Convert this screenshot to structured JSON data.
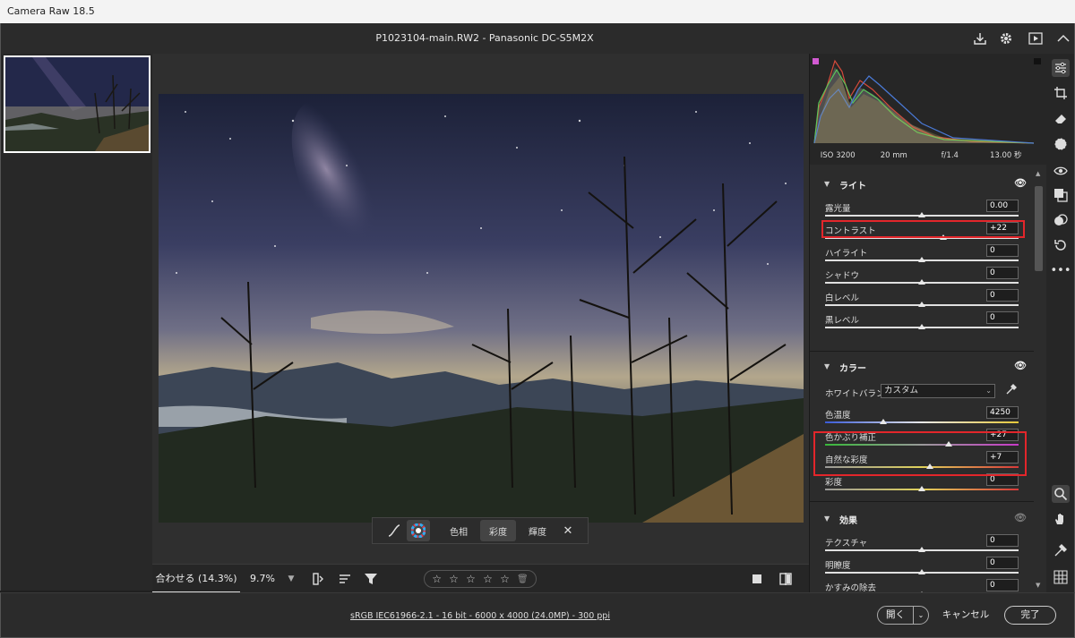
{
  "window": {
    "title": "Camera Raw 18.5"
  },
  "header": {
    "filename": "P1023104-main.RW2  -  Panasonic DC-S5M2X"
  },
  "histogram": {
    "iso": "ISO 3200",
    "focal": "20 mm",
    "aperture": "f/1.4",
    "shutter": "13.00 秒"
  },
  "light": {
    "title": "ライト",
    "sliders": [
      {
        "label": "露光量",
        "value": "0.00",
        "position": 0.5
      },
      {
        "label": "コントラスト",
        "value": "+22",
        "position": 0.61
      },
      {
        "label": "ハイライト",
        "value": "0",
        "position": 0.5
      },
      {
        "label": "シャドウ",
        "value": "0",
        "position": 0.5
      },
      {
        "label": "白レベル",
        "value": "0",
        "position": 0.5
      },
      {
        "label": "黒レベル",
        "value": "0",
        "position": 0.5
      }
    ]
  },
  "color": {
    "title": "カラー",
    "wb_label": "ホワイトバランス",
    "wb_value": "カスタム",
    "sliders": [
      {
        "label": "色温度",
        "value": "4250",
        "position": 0.3
      },
      {
        "label": "色かぶり補正",
        "value": "+27",
        "position": 0.64
      },
      {
        "label": "自然な彩度",
        "value": "+7",
        "position": 0.54
      },
      {
        "label": "彩度",
        "value": "0",
        "position": 0.5
      }
    ]
  },
  "effects": {
    "title": "効果",
    "sliders": [
      {
        "label": "テクスチャ",
        "value": "0",
        "position": 0.5
      },
      {
        "label": "明瞭度",
        "value": "0",
        "position": 0.5
      },
      {
        "label": "かすみの除去",
        "value": "0",
        "position": 0.5
      }
    ]
  },
  "maskbar": {
    "hue": "色相",
    "saturation": "彩度",
    "luminance": "輝度"
  },
  "bottombar": {
    "fit": "合わせる (14.3%)",
    "zoom": "9.7%"
  },
  "status": {
    "info": "sRGB IEC61966-2.1 - 16 bit - 6000 x 4000 (24.0MP) - 300 ppi",
    "open": "開く",
    "cancel": "キャンセル",
    "done": "完了"
  }
}
